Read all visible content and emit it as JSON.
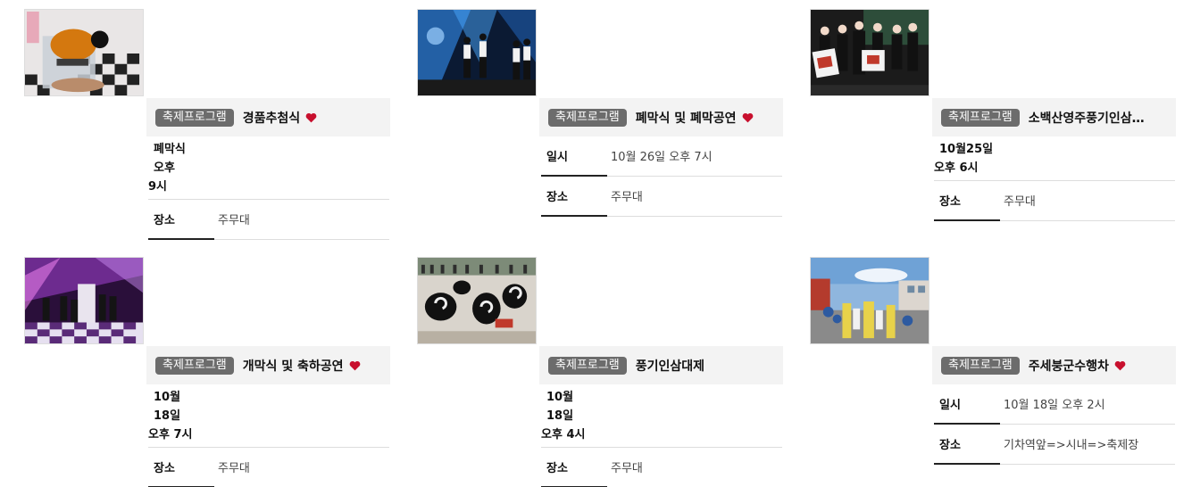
{
  "cards": [
    {
      "badge": "축제프로그램",
      "title": "경품추첨식",
      "heart": true,
      "date_line1": "폐막식 오후",
      "date_line2": "9시",
      "place_label": "장소",
      "place_value": "주무대"
    },
    {
      "badge": "축제프로그램",
      "title": "폐막식 및 폐막공연",
      "heart": true,
      "date_label": "일시",
      "date_value": "10월 26일 오후 7시",
      "place_label": "장소",
      "place_value": "주무대"
    },
    {
      "badge": "축제프로그램",
      "title": "소백산영주풍기인삼…",
      "heart": false,
      "date_line1": "10월25일",
      "date_line2": "오후 6시",
      "place_label": "장소",
      "place_value": "주무대"
    },
    {
      "badge": "축제프로그램",
      "title": "개막식 및 축하공연",
      "heart": true,
      "date_line1": "10월 18일",
      "date_line2": "오후 7시",
      "place_label": "장소",
      "place_value": "주무대"
    },
    {
      "badge": "축제프로그램",
      "title": "풍기인삼대제",
      "heart": false,
      "date_line1": "10월 18일",
      "date_line2": "오후 4시",
      "place_label": "장소",
      "place_value": "주무대"
    },
    {
      "badge": "축제프로그램",
      "title": "주세붕군수행차",
      "heart": true,
      "date_label": "일시",
      "date_value": "10월 18일 오후 2시",
      "place_label": "장소",
      "place_value": "기차역앞=>시내=>축제장"
    }
  ],
  "colors": {
    "badge_bg": "#6c6c6c",
    "heart": "#c8102e",
    "header_bg": "#f3f3f3"
  },
  "icons": {
    "heart": "heart-icon"
  }
}
